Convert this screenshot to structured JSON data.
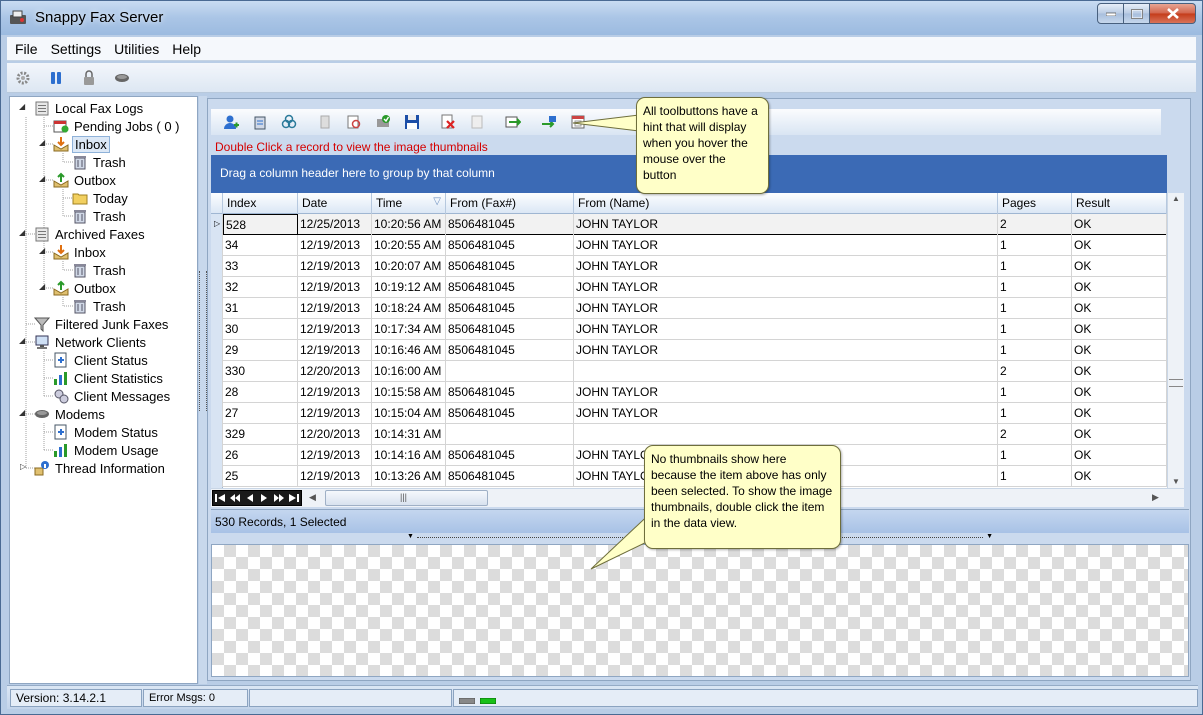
{
  "window": {
    "title": "Snappy Fax Server"
  },
  "menu": [
    "File",
    "Settings",
    "Utilities",
    "Help"
  ],
  "tree": {
    "local_fax_logs": "Local Fax Logs",
    "pending_jobs": "Pending Jobs ( 0 )",
    "inbox": "Inbox",
    "trash": "Trash",
    "outbox": "Outbox",
    "today": "Today",
    "archived_faxes": "Archived Faxes",
    "filtered_junk_faxes": "Filtered Junk Faxes",
    "network_clients": "Network Clients",
    "client_status": "Client Status",
    "client_statistics": "Client Statistics",
    "client_messages": "Client Messages",
    "modems": "Modems",
    "modem_status": "Modem  Status",
    "modem_usage": "Modem  Usage",
    "thread_information": "Thread Information"
  },
  "hint_text": "Double Click a record to view the image thumbnails",
  "group_hint": "Drag a column header here to group by that column",
  "columns": [
    "Index",
    "Date",
    "Time",
    "From (Fax#)",
    "From (Name)",
    "Pages",
    "Result"
  ],
  "rows": [
    [
      "528",
      "12/25/2013",
      "10:20:56 AM",
      "8506481045",
      "JOHN TAYLOR",
      "2",
      "OK"
    ],
    [
      "34",
      "12/19/2013",
      "10:20:55 AM",
      "8506481045",
      "JOHN TAYLOR",
      "1",
      "OK"
    ],
    [
      "33",
      "12/19/2013",
      "10:20:07 AM",
      "8506481045",
      "JOHN TAYLOR",
      "1",
      "OK"
    ],
    [
      "32",
      "12/19/2013",
      "10:19:12 AM",
      "8506481045",
      "JOHN TAYLOR",
      "1",
      "OK"
    ],
    [
      "31",
      "12/19/2013",
      "10:18:24 AM",
      "8506481045",
      "JOHN TAYLOR",
      "1",
      "OK"
    ],
    [
      "30",
      "12/19/2013",
      "10:17:34 AM",
      "8506481045",
      "JOHN TAYLOR",
      "1",
      "OK"
    ],
    [
      "29",
      "12/19/2013",
      "10:16:46 AM",
      "8506481045",
      "JOHN TAYLOR",
      "1",
      "OK"
    ],
    [
      "330",
      "12/20/2013",
      "10:16:00 AM",
      "",
      "",
      "2",
      "OK"
    ],
    [
      "28",
      "12/19/2013",
      "10:15:58 AM",
      "8506481045",
      "JOHN TAYLOR",
      "1",
      "OK"
    ],
    [
      "27",
      "12/19/2013",
      "10:15:04 AM",
      "8506481045",
      "JOHN TAYLOR",
      "1",
      "OK"
    ],
    [
      "329",
      "12/20/2013",
      "10:14:31 AM",
      "",
      "",
      "2",
      "OK"
    ],
    [
      "26",
      "12/19/2013",
      "10:14:16 AM",
      "8506481045",
      "JOHN TAYLOR",
      "1",
      "OK"
    ],
    [
      "25",
      "12/19/2013",
      "10:13:26 AM",
      "8506481045",
      "JOHN TAYLOR",
      "1",
      "OK"
    ]
  ],
  "record_status": "530 Records, 1 Selected",
  "callouts": {
    "toolbar_hint": "All toolbuttons have a hint that will display when you hover the mouse over the button",
    "thumbnail_hint": "No thumbnails show here because the item above has only been selected.  To show the image thumbnails, double click the item in the data view."
  },
  "statusbar": {
    "version": "Version: 3.14.2.1",
    "errors": "Error Msgs: 0"
  },
  "scroll_grip": "|||",
  "colors": {
    "group_bar": "#3b6ab5",
    "hint_red": "#d40000",
    "callout_bg": "#ffffc8",
    "accent": "#4a86d4"
  }
}
